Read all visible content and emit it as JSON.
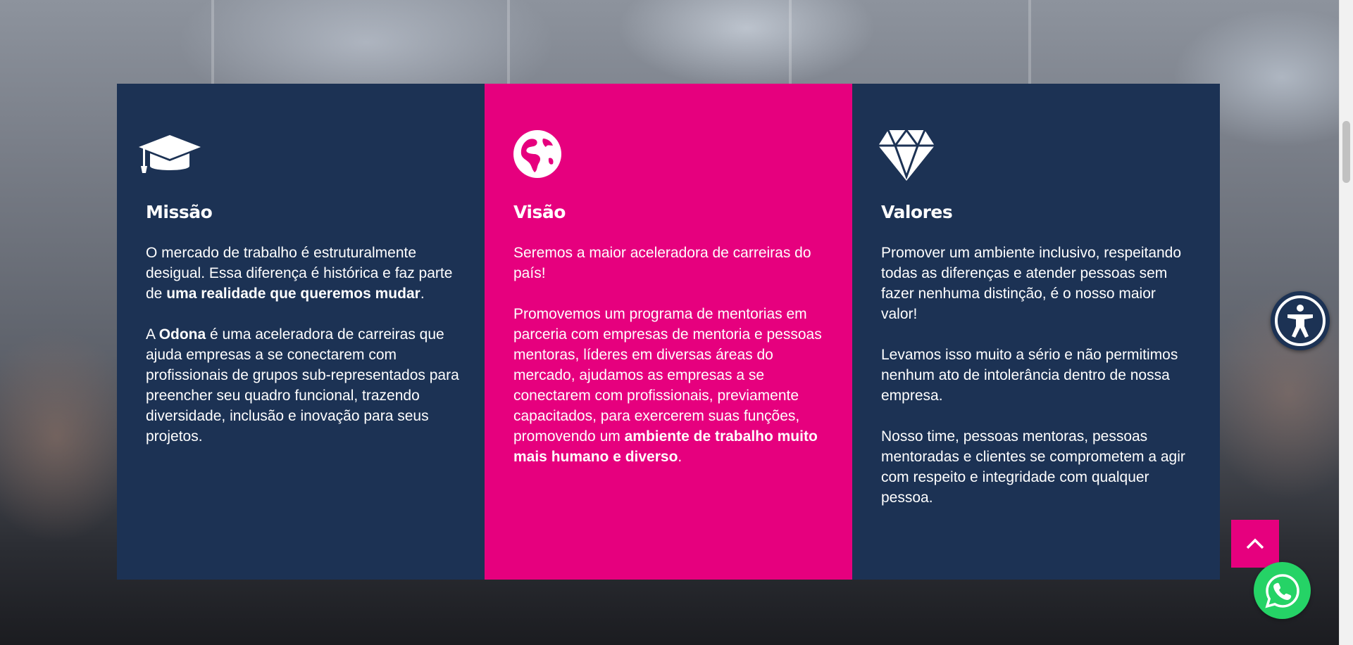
{
  "colors": {
    "navy": "#1c3254",
    "pink": "#e6007e",
    "whatsapp_green": "#25d366"
  },
  "cards": [
    {
      "icon": "graduation-cap-icon",
      "title": "Missão",
      "p1_a": "O mercado de trabalho é estruturalmente desigual. Essa diferença é histórica e faz parte de ",
      "p1_b": "uma realidade que queremos mudar",
      "p1_c": ".",
      "p2_a": "A ",
      "p2_b": "Odona",
      "p2_c": " é uma aceleradora de carreiras que ajuda empresas a se conectarem com profissionais de grupos sub-representados para preencher seu quadro funcional, trazendo diversidade, inclusão e inovação para seus projetos."
    },
    {
      "icon": "globe-icon",
      "title": "Visão",
      "p1": "Seremos a maior aceleradora de carreiras do país!",
      "p2_a": "Promovemos um programa de mentorias em parceria com empresas de mentoria e pessoas mentoras, líderes em diversas áreas do mercado, ajudamos as empresas a se conectarem com profissionais, previamente capacitados, para exercerem suas funções, promovendo um ",
      "p2_b": "ambiente de trabalho muito mais humano e diverso",
      "p2_c": "."
    },
    {
      "icon": "diamond-icon",
      "title": "Valores",
      "p1": "Promover um ambiente inclusivo, respeitando todas as diferenças e atender pessoas sem fazer nenhuma distinção, é o nosso maior valor!",
      "p2": "Levamos isso muito a sério e não permitimos nenhum ato de intolerância dentro de nossa empresa.",
      "p3": "Nosso time, pessoas mentoras, pessoas mentoradas e clientes se comprometem a agir com respeito e integridade com qualquer pessoa."
    }
  ],
  "floating": {
    "accessibility_icon": "accessibility-icon",
    "scroll_top_icon": "chevron-up-icon",
    "whatsapp_icon": "whatsapp-icon"
  }
}
